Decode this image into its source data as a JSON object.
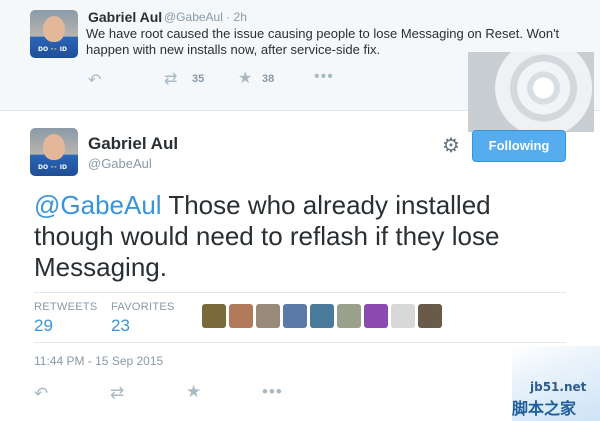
{
  "parent_tweet": {
    "name": "Gabriel Aul",
    "handle_time": "@GabeAul · 2h",
    "text": "We have root caused the issue causing people to lose Messaging on Reset. Won't happen with new installs now, after service-side fix.",
    "retweet_count": "35",
    "favorite_count": "38",
    "avatar_tag": "DO 👓 ID"
  },
  "main_tweet": {
    "name": "Gabriel Aul",
    "handle": "@GabeAul",
    "follow_label": "Following",
    "mention": "@GabeAul",
    "text": " Those who already installed though would need to reflash if they lose Messaging.",
    "retweets_label": "RETWEETS",
    "retweets_value": "29",
    "favorites_label": "FAVORITES",
    "favorites_value": "23",
    "timestamp": "11:44 PM - 15 Sep 2015",
    "avatar_tag": "DO 👓 ID"
  },
  "favoriters": [
    {
      "color": "#7a6a3a"
    },
    {
      "color": "#b07a5a"
    },
    {
      "color": "#9a8a7a"
    },
    {
      "color": "#5a7aa8"
    },
    {
      "color": "#4a7a9a"
    },
    {
      "color": "#9aa08a"
    },
    {
      "color": "#8a4ab0"
    },
    {
      "color": "#d8d8d8"
    },
    {
      "color": "#6a5a4a"
    }
  ],
  "watermark": {
    "site": "jb51.net",
    "brand": "脚本之家"
  },
  "colors": {
    "accent": "#55acee",
    "link": "#3b94d9",
    "muted": "#8899a6",
    "icon": "#aab8c2"
  }
}
